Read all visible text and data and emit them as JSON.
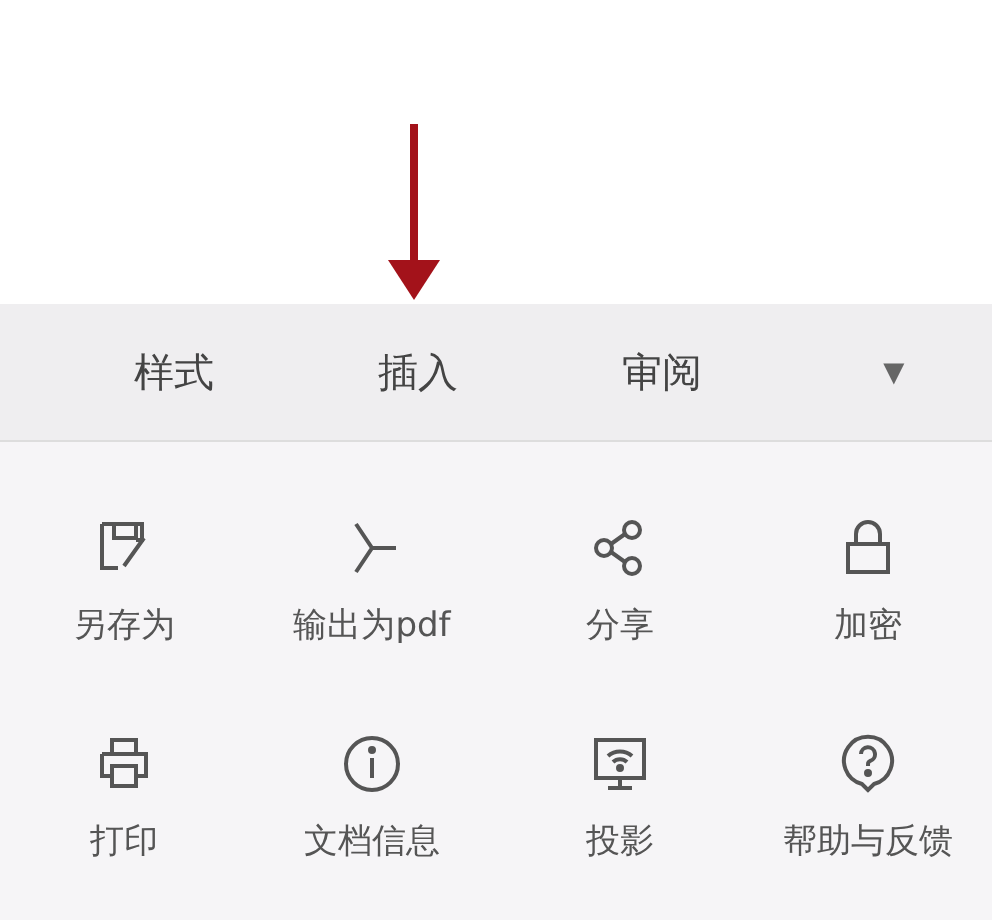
{
  "tabs": [
    {
      "label": "样式",
      "selected": false
    },
    {
      "label": "插入",
      "selected": false
    },
    {
      "label": "审阅",
      "selected": false
    }
  ],
  "tab_menu": {
    "icon": "▼"
  },
  "actions": [
    {
      "kind": "save-as",
      "label": "另存为"
    },
    {
      "kind": "export",
      "label": "输出为pdf"
    },
    {
      "kind": "share",
      "label": "分享"
    },
    {
      "kind": "lock",
      "label": "加密"
    },
    {
      "kind": "print",
      "label": "打印"
    },
    {
      "kind": "info",
      "label": "文档信息"
    },
    {
      "kind": "cast",
      "label": "投影"
    },
    {
      "kind": "help",
      "label": "帮助与反馈"
    }
  ]
}
